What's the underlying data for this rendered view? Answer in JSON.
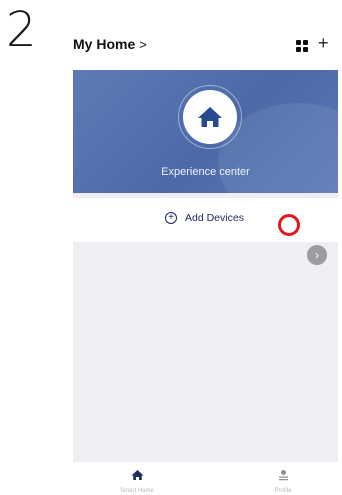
{
  "step": {
    "number": "2"
  },
  "header": {
    "title": "My Home",
    "title_chevron": ">",
    "add_symbol": "+"
  },
  "banner": {
    "label": "Experience center",
    "icon": "house-icon",
    "color": "#5371ae"
  },
  "add_devices": {
    "label": "Add Devices",
    "icon": "add-circle-icon",
    "symbol": "+"
  },
  "annotation": {
    "marker_color": "#e4161b"
  },
  "floating": {
    "arrow": "›",
    "icon": "chevron-right-icon"
  },
  "bottom_nav": {
    "items": [
      {
        "label": "Smart Home",
        "icon": "house-icon"
      },
      {
        "label": "Profile",
        "icon": "person-icon"
      }
    ]
  }
}
